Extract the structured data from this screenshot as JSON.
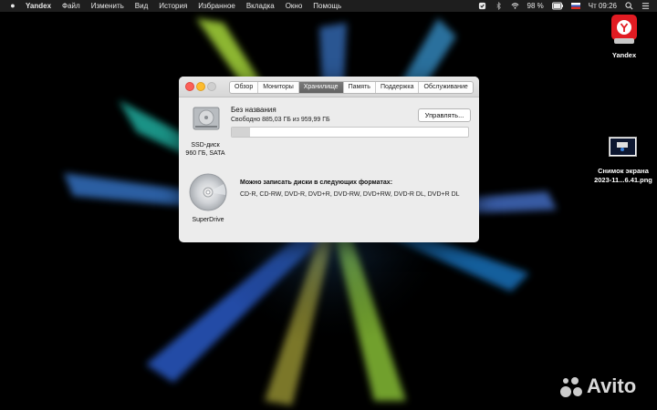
{
  "menubar": {
    "app_name": "Yandex",
    "items": [
      "Файл",
      "Изменить",
      "Вид",
      "История",
      "Избранное",
      "Вкладка",
      "Окно",
      "Помощь"
    ],
    "battery": "98 %",
    "clock": "Чт 09:26"
  },
  "window": {
    "tabs": [
      {
        "label": "Обзор",
        "active": false
      },
      {
        "label": "Мониторы",
        "active": false
      },
      {
        "label": "Хранилище",
        "active": true
      },
      {
        "label": "Память",
        "active": false
      },
      {
        "label": "Поддержка",
        "active": false
      },
      {
        "label": "Обслуживание",
        "active": false
      }
    ],
    "disk": {
      "name": "Без названия",
      "free_text": "Свободно 885,03 ГБ из 959,99 ГБ",
      "used_fraction": 0.078,
      "label_line1": "SSD-диск",
      "label_line2": "960 ГБ, SATA",
      "manage_label": "Управлять..."
    },
    "optical": {
      "label": "SuperDrive",
      "formats_title": "Можно записать диски в следующих форматах:",
      "formats": "CD-R, CD-RW, DVD-R, DVD+R, DVD-RW, DVD+RW, DVD-R DL, DVD+R DL"
    }
  },
  "desktop": {
    "yandex_label": "Yandex",
    "screenshot_label_line1": "Снимок экрана",
    "screenshot_label_line2": "2023-11...6.41.png"
  },
  "watermark": "Avito",
  "colors": {
    "accent_tab": "#6b6b6b",
    "yandex_red": "#e11b22",
    "close": "#fc5f57",
    "minimize": "#fdbc2e"
  }
}
